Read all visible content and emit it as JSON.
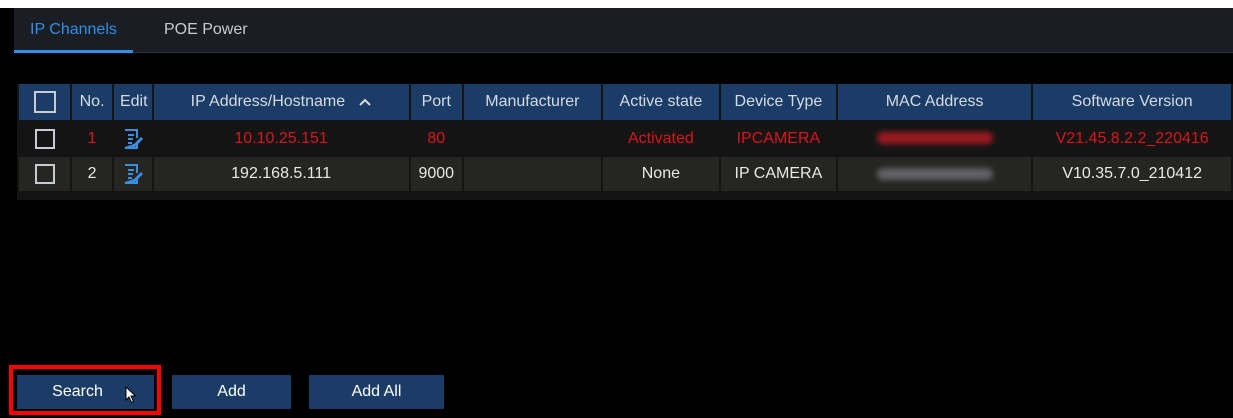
{
  "tabs": [
    {
      "label": "IP Channels"
    },
    {
      "label": "POE Power"
    }
  ],
  "table": {
    "headers": [
      "No.",
      "Edit",
      "IP Address/Hostname",
      "Port",
      "Manufacturer",
      "Active state",
      "Device Type",
      "MAC Address",
      "Software Version"
    ],
    "sort_indicator": "^",
    "rows": [
      {
        "no": "1",
        "ip": "10.10.25.151",
        "port": "80",
        "manufacturer": "",
        "state": "Activated",
        "type": "IPCAMERA",
        "version": "V21.45.8.2.2_220416"
      },
      {
        "no": "2",
        "ip": "192.168.5.111",
        "port": "9000",
        "manufacturer": "",
        "state": "None",
        "type": "IP CAMERA",
        "version": "V10.35.7.0_210412"
      }
    ]
  },
  "buttons": {
    "search": "Search",
    "add": "Add",
    "add_all": "Add All"
  },
  "colors": {
    "accent": "#2e8fe8",
    "header_bg": "#1a3c66",
    "highlight_red": "#d8171c",
    "annotation_red": "#ff0000"
  },
  "icons": {
    "edit": "edit-icon",
    "sort": "sort-ascending-icon",
    "cursor": "mouse-pointer-icon"
  }
}
